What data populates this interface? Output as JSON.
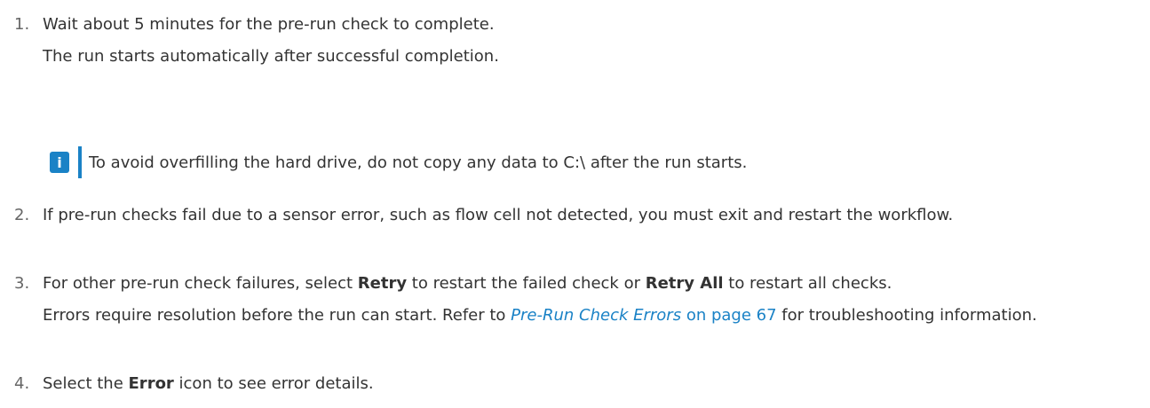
{
  "colors": {
    "accent": "#1a82c6",
    "text": "#333333",
    "number": "#666666"
  },
  "steps": [
    {
      "number": "1.",
      "line1": "Wait about 5 minutes for the pre-run check to complete.",
      "line2": "The run starts automatically after successful completion."
    },
    {
      "number": "2.",
      "text": "If pre-run checks fail due to a sensor error, such as flow cell not detected, you must exit and restart the workflow."
    },
    {
      "number": "3.",
      "before": "For other pre-run check failures, select ",
      "retry": "Retry",
      "middle": " to restart the failed check or ",
      "retry_all": "Retry All",
      "after": " to restart all checks.",
      "errors_before": "Errors require resolution before the run can start. Refer to ",
      "link_title": "Pre-Run Check Errors",
      "link_page": " on page 67",
      "errors_after": " for troubleshooting information."
    },
    {
      "number": "4.",
      "before": "Select the ",
      "bold": "Error",
      "after": " icon to see error details."
    }
  ],
  "note": {
    "icon": "info-icon",
    "icon_glyph": "i",
    "text": "To avoid overfilling the hard drive, do not copy any data to C:\\ after the run starts."
  }
}
